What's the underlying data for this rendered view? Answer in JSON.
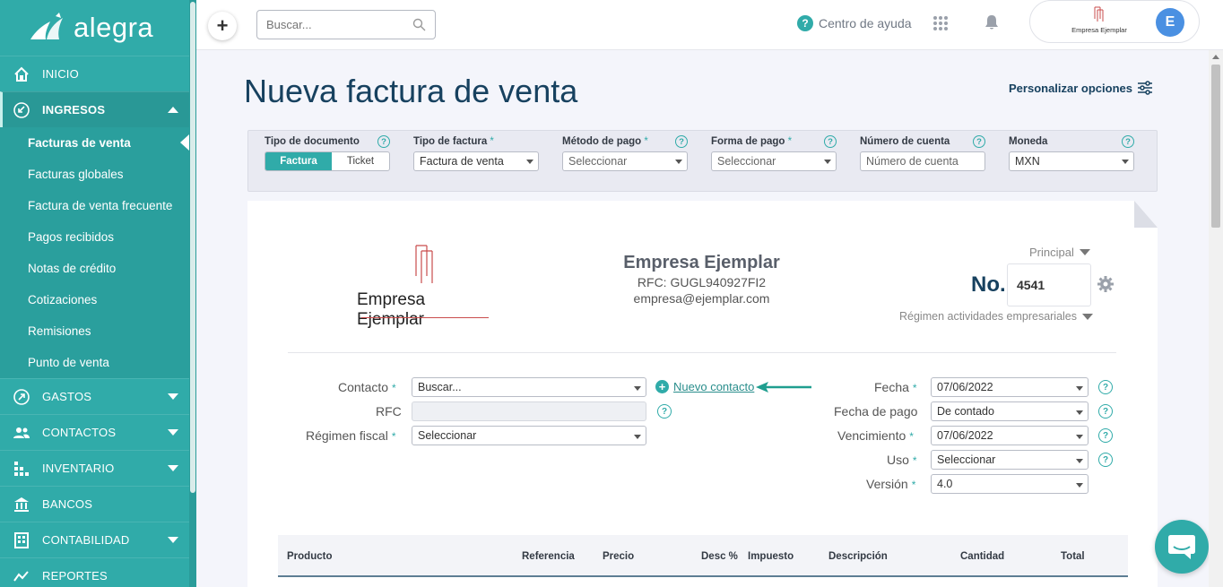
{
  "brand": {
    "name": "alegra"
  },
  "sidebar": {
    "items": [
      {
        "label": "INICIO",
        "icon": "home-icon"
      },
      {
        "label": "INGRESOS",
        "icon": "income-icon"
      },
      {
        "label": "GASTOS",
        "icon": "expenses-icon"
      },
      {
        "label": "CONTACTOS",
        "icon": "contacts-icon"
      },
      {
        "label": "INVENTARIO",
        "icon": "inventory-icon"
      },
      {
        "label": "BANCOS",
        "icon": "bank-icon"
      },
      {
        "label": "CONTABILIDAD",
        "icon": "accounting-icon"
      },
      {
        "label": "REPORTES",
        "icon": "reports-icon"
      }
    ],
    "ingresos_sub": [
      "Facturas de venta",
      "Facturas globales",
      "Factura de venta frecuente",
      "Pagos recibidos",
      "Notas de crédito",
      "Cotizaciones",
      "Remisiones",
      "Punto de venta"
    ]
  },
  "topbar": {
    "add_label": "+",
    "search_placeholder": "Buscar...",
    "help_label": "Centro de ayuda",
    "profile_company": "Empresa Ejemplar",
    "avatar_initial": "E"
  },
  "page": {
    "title": "Nueva factura de venta",
    "customize_label": "Personalizar opciones"
  },
  "options": {
    "doc_type_label": "Tipo de documento",
    "doc_type_on": "Factura",
    "doc_type_off": "Ticket",
    "invoice_type_label": "Tipo de factura",
    "invoice_type_value": "Factura de venta",
    "payment_method_label": "Método de pago",
    "payment_method_value": "Seleccionar",
    "payment_form_label": "Forma de pago",
    "payment_form_value": "Seleccionar",
    "account_label": "Número de cuenta",
    "account_placeholder": "Número de cuenta",
    "currency_label": "Moneda",
    "currency_value": "MXN",
    "required_mark": "*",
    "help_mark": "?"
  },
  "company": {
    "logo_text": "Empresa Ejemplar",
    "name": "Empresa Ejemplar",
    "rfc": "RFC: GUGL940927FI2",
    "email": "empresa@ejemplar.com"
  },
  "numbering": {
    "template": "Principal",
    "no_label": "No.",
    "number": "4541",
    "regime": "Régimen actividades empresariales"
  },
  "form": {
    "contact_label": "Contacto",
    "contact_placeholder": "Buscar...",
    "new_contact": "Nuevo contacto",
    "rfc_label": "RFC",
    "rfc_value": "",
    "fiscal_regime_label": "Régimen fiscal",
    "fiscal_regime_value": "Seleccionar",
    "date_label": "Fecha",
    "date_value": "07/06/2022",
    "payment_date_label": "Fecha de pago",
    "payment_date_value": "De contado",
    "due_label": "Vencimiento",
    "due_value": "07/06/2022",
    "use_label": "Uso",
    "use_value": "Seleccionar",
    "version_label": "Versión",
    "version_value": "4.0"
  },
  "table": {
    "columns": [
      "Producto",
      "Referencia",
      "Precio",
      "Desc %",
      "Impuesto",
      "Descripción",
      "Cantidad",
      "Total"
    ]
  },
  "colors": {
    "accent": "#30aba9",
    "title": "#17415f"
  }
}
